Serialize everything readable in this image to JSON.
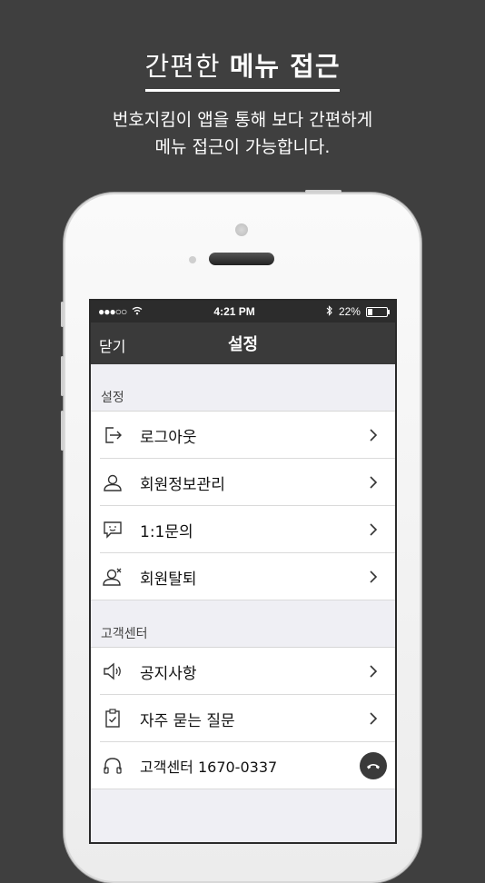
{
  "promo": {
    "title_plain": "간편한 ",
    "title_bold": "메뉴 접근",
    "subtitle_line1": "번호지킴이 앱을 통해 보다 간편하게",
    "subtitle_line2": "메뉴 접근이 가능합니다."
  },
  "statusbar": {
    "signal": "●●●○○",
    "time": "4:21 PM",
    "battery": "22%"
  },
  "navbar": {
    "close_label": "닫기",
    "title": "설정"
  },
  "sections": [
    {
      "header": "설정",
      "items": [
        {
          "label": "로그아웃",
          "icon": "logout-icon"
        },
        {
          "label": "회원정보관리",
          "icon": "user-icon"
        },
        {
          "label": "1:1문의",
          "icon": "chat-icon"
        },
        {
          "label": "회원탈퇴",
          "icon": "user-remove-icon"
        }
      ]
    },
    {
      "header": "고객센터",
      "items": [
        {
          "label": "공지사항",
          "icon": "speaker-icon"
        },
        {
          "label": "자주 묻는 질문",
          "icon": "clipboard-icon"
        },
        {
          "label": "고객센터 1670-0337",
          "icon": "headphones-icon",
          "action_icon": "phone-call-icon"
        }
      ]
    }
  ],
  "colors": {
    "background": "#3f3f3f",
    "navbar": "#3a3a3a",
    "statusbar": "#2c2c2c",
    "list_background": "#ffffff",
    "screen_background": "#efeff4"
  }
}
